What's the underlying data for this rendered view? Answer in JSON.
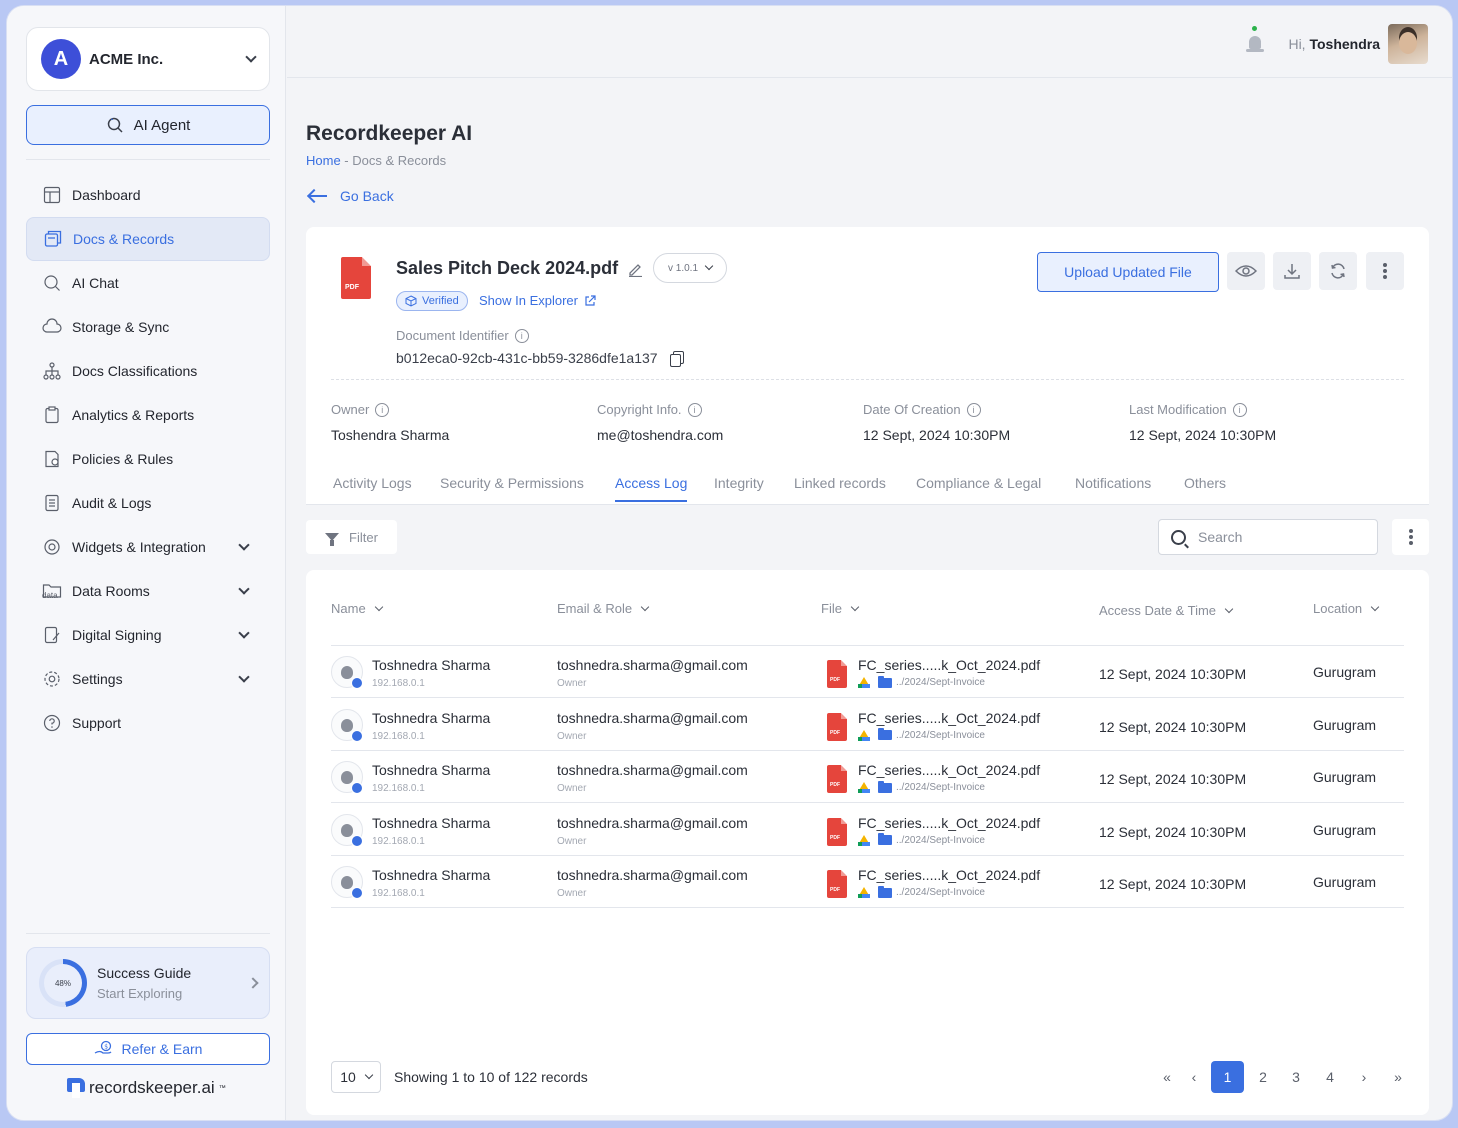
{
  "org": {
    "name": "ACME Inc.",
    "logo_letter": "A"
  },
  "sidebar": {
    "ai_agent_label": "AI Agent",
    "items": [
      {
        "label": "Dashboard",
        "icon": "dashboard-icon"
      },
      {
        "label": "Docs & Records",
        "icon": "docs-icon",
        "active": true
      },
      {
        "label": "AI Chat",
        "icon": "ai-chat-icon"
      },
      {
        "label": "Storage & Sync",
        "icon": "cloud-sync-icon"
      },
      {
        "label": "Docs Classifications",
        "icon": "hierarchy-icon"
      },
      {
        "label": "Analytics & Reports",
        "icon": "clipboard-icon"
      },
      {
        "label": "Policies & Rules",
        "icon": "policy-icon"
      },
      {
        "label": "Audit & Logs",
        "icon": "list-icon"
      },
      {
        "label": "Widgets & Integration",
        "icon": "widgets-icon",
        "expandable": true
      },
      {
        "label": "Data Rooms",
        "icon": "folder-data-icon",
        "expandable": true,
        "icon_text": "data"
      },
      {
        "label": "Digital Signing",
        "icon": "signature-icon",
        "expandable": true
      },
      {
        "label": "Settings",
        "icon": "gear-icon",
        "expandable": true
      },
      {
        "label": "Support",
        "icon": "help-icon"
      }
    ],
    "guide": {
      "title": "Success Guide",
      "subtitle": "Start Exploring",
      "progress": "48%"
    },
    "refer_label": "Refer & Earn",
    "brand": "recordskeeper.ai",
    "brand_tm": "™"
  },
  "topbar": {
    "greeting_prefix": "Hi,",
    "user_name": "Toshendra"
  },
  "page": {
    "title": "Recordkeeper AI",
    "breadcrumb_home": "Home",
    "breadcrumb_rest": " - Docs & Records",
    "go_back": "Go Back"
  },
  "document": {
    "name": "Sales Pitch Deck 2024.pdf",
    "version": "v 1.0.1",
    "pdf_tag": "PDF",
    "verified_label": "Verified",
    "explorer_label": "Show In Explorer",
    "identifier_label": "Document Identifier",
    "identifier": "b012eca0-92cb-431c-bb59-3286dfe1a137",
    "upload_label": "Upload Updated File",
    "meta": [
      {
        "label": "Owner",
        "value": "Toshendra Sharma"
      },
      {
        "label": "Copyright Info.",
        "value": "me@toshendra.com"
      },
      {
        "label": "Date Of Creation",
        "value": "12 Sept, 2024 10:30PM"
      },
      {
        "label": "Last Modification",
        "value": "12 Sept, 2024 10:30PM"
      }
    ]
  },
  "tabs": [
    "Activity Logs",
    "Security & Permissions",
    "Access Log",
    "Integrity",
    "Linked records",
    "Compliance & Legal",
    "Notifications",
    "Others"
  ],
  "active_tab": "Access Log",
  "toolbar": {
    "filter_label": "Filter",
    "search_placeholder": "Search"
  },
  "table": {
    "columns": [
      "Name",
      "Email & Role",
      "File",
      "Access Date & Time",
      "Location"
    ],
    "rows": [
      {
        "name": "Toshnedra Sharma",
        "ip": "192.168.0.1",
        "email": "toshnedra.sharma@gmail.com",
        "role": "Owner",
        "file": "FC_series.....k_Oct_2024.pdf",
        "path": "../2024/Sept-Invoice",
        "datetime": "12 Sept, 2024 10:30PM",
        "location": "Gurugram"
      },
      {
        "name": "Toshnedra Sharma",
        "ip": "192.168.0.1",
        "email": "toshnedra.sharma@gmail.com",
        "role": "Owner",
        "file": "FC_series.....k_Oct_2024.pdf",
        "path": "../2024/Sept-Invoice",
        "datetime": "12 Sept, 2024 10:30PM",
        "location": "Gurugram"
      },
      {
        "name": "Toshnedra Sharma",
        "ip": "192.168.0.1",
        "email": "toshnedra.sharma@gmail.com",
        "role": "Owner",
        "file": "FC_series.....k_Oct_2024.pdf",
        "path": "../2024/Sept-Invoice",
        "datetime": "12 Sept, 2024 10:30PM",
        "location": "Gurugram"
      },
      {
        "name": "Toshnedra Sharma",
        "ip": "192.168.0.1",
        "email": "toshnedra.sharma@gmail.com",
        "role": "Owner",
        "file": "FC_series.....k_Oct_2024.pdf",
        "path": "../2024/Sept-Invoice",
        "datetime": "12 Sept, 2024 10:30PM",
        "location": "Gurugram"
      },
      {
        "name": "Toshnedra Sharma",
        "ip": "192.168.0.1",
        "email": "toshnedra.sharma@gmail.com",
        "role": "Owner",
        "file": "FC_series.....k_Oct_2024.pdf",
        "path": "../2024/Sept-Invoice",
        "datetime": "12 Sept, 2024 10:30PM",
        "location": "Gurugram"
      }
    ]
  },
  "pagination": {
    "per_page": "10",
    "showing": "Showing 1 to 10 of 122 records",
    "first": "«",
    "prev": "‹",
    "next": "›",
    "last": "»",
    "pages": [
      "1",
      "2",
      "3",
      "4"
    ],
    "current": "1"
  },
  "colors": {
    "accent": "#3a6fe0",
    "pdf": "#e5453c",
    "org_logo": "#3d4fd8"
  }
}
